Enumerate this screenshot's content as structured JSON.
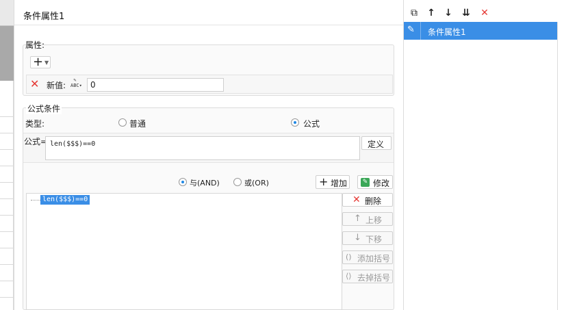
{
  "dialog": {
    "title": "条件属性1",
    "attributes": {
      "label": "属性:",
      "new_value_label": "新值:",
      "new_value": "0"
    },
    "formula_condition": {
      "label": "公式条件",
      "type_label": "类型:",
      "options": [
        "普通",
        "公式"
      ],
      "selected": "公式",
      "formula_label": "公式=",
      "formula_value": "len($$$)==0",
      "define_button": "定义"
    },
    "logic": {
      "and_label": "与(AND)",
      "or_label": "或(OR)",
      "selected": "与(AND)",
      "add_button": "增加",
      "modify_button": "修改"
    },
    "conditions": [
      "len($$$)==0"
    ],
    "side_buttons": {
      "delete": "删除",
      "move_up": "上移",
      "move_down": "下移",
      "add_bracket": "添加括号",
      "remove_bracket": "去掉括号"
    }
  },
  "right_panel": {
    "items": [
      "条件属性1"
    ],
    "icons": [
      "copy-icon",
      "arrow-up-icon",
      "arrow-down-icon",
      "move-bottom-icon",
      "delete-icon"
    ]
  }
}
